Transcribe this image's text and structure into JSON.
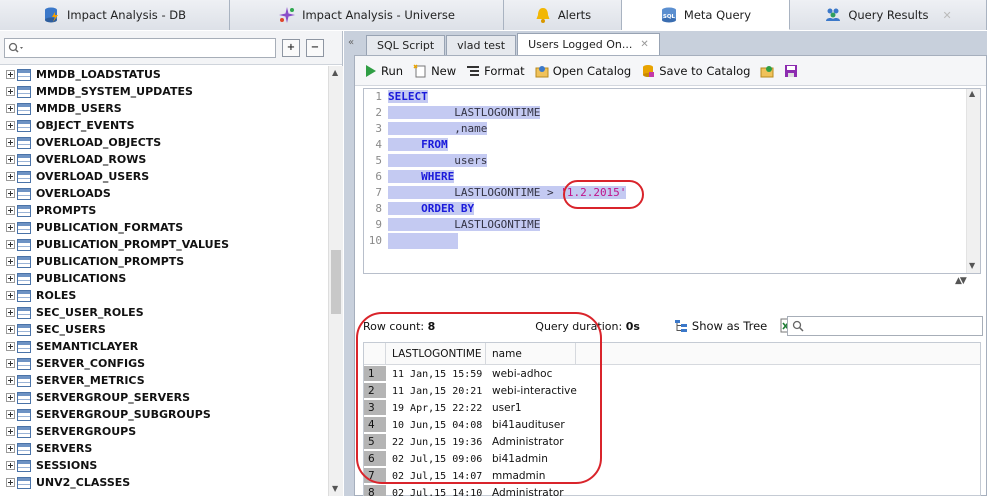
{
  "top_tabs": [
    {
      "label": "Impact Analysis - DB",
      "icon": "database-bolt-icon"
    },
    {
      "label": "Impact Analysis - Universe",
      "icon": "universe-spark-icon"
    },
    {
      "label": "Alerts",
      "icon": "bell-icon"
    },
    {
      "label": "Meta Query",
      "icon": "sql-database-icon",
      "active": true
    },
    {
      "label": "Query Results",
      "icon": "users-group-icon",
      "close": "✕"
    }
  ],
  "left": {
    "search_placeholder": "",
    "expand_all": "+",
    "collapse_all": "−",
    "tree_items": [
      "MMDB_LOADSTATUS",
      "MMDB_SYSTEM_UPDATES",
      "MMDB_USERS",
      "OBJECT_EVENTS",
      "OVERLOAD_OBJECTS",
      "OVERLOAD_ROWS",
      "OVERLOAD_USERS",
      "OVERLOADS",
      "PROMPTS",
      "PUBLICATION_FORMATS",
      "PUBLICATION_PROMPT_VALUES",
      "PUBLICATION_PROMPTS",
      "PUBLICATIONS",
      "ROLES",
      "SEC_USER_ROLES",
      "SEC_USERS",
      "SEMANTICLAYER",
      "SERVER_CONFIGS",
      "SERVER_METRICS",
      "SERVERGROUP_SERVERS",
      "SERVERGROUP_SUBGROUPS",
      "SERVERGROUPS",
      "SERVERS",
      "SESSIONS",
      "UNV2_CLASSES"
    ]
  },
  "doc_tabs": [
    {
      "label": "SQL Script"
    },
    {
      "label": "vlad test"
    },
    {
      "label": "Users Logged On...",
      "active": true,
      "close": "✕"
    }
  ],
  "toolbar": {
    "run": "Run",
    "new": "New",
    "format": "Format",
    "open_catalog": "Open Catalog",
    "save_to_catalog": "Save to Catalog"
  },
  "code_lines": [
    {
      "n": "1",
      "indent": "",
      "text": "SELECT",
      "kind": "kw"
    },
    {
      "n": "2",
      "indent": "          ",
      "text": "LASTLOGONTIME",
      "kind": "id"
    },
    {
      "n": "3",
      "indent": "          ",
      "text": ",name",
      "kind": "id"
    },
    {
      "n": "4",
      "indent": "     ",
      "text": "FROM",
      "kind": "kw"
    },
    {
      "n": "5",
      "indent": "          ",
      "text": "users",
      "kind": "id"
    },
    {
      "n": "6",
      "indent": "     ",
      "text": "WHERE",
      "kind": "kw"
    },
    {
      "n": "7",
      "indent": "          ",
      "text": "LASTLOGONTIME > ",
      "kind": "id",
      "string": "'1.2.2015'"
    },
    {
      "n": "8",
      "indent": "     ",
      "text": "ORDER BY",
      "kind": "kw"
    },
    {
      "n": "9",
      "indent": "          ",
      "text": "LASTLOGONTIME",
      "kind": "id"
    },
    {
      "n": "10",
      "indent": "",
      "text": "",
      "kind": "id"
    }
  ],
  "status": {
    "row_count_label": "Row count:",
    "row_count": "8",
    "duration_label": "Query duration:",
    "duration": "0s",
    "show_as_tree": "Show as Tree",
    "search_placeholder": ""
  },
  "results": {
    "columns": [
      "LASTLOGONTIME",
      "name"
    ],
    "rows": [
      {
        "n": "1",
        "time": "11 Jan,15 15:59",
        "name": "webi-adhoc"
      },
      {
        "n": "2",
        "time": "11 Jan,15 20:21",
        "name": "webi-interactive"
      },
      {
        "n": "3",
        "time": "19 Apr,15 22:22",
        "name": "user1"
      },
      {
        "n": "4",
        "time": "10 Jun,15 04:08",
        "name": "bi41audituser"
      },
      {
        "n": "5",
        "time": "22 Jun,15 19:36",
        "name": "Administrator"
      },
      {
        "n": "6",
        "time": "02 Jul,15 09:06",
        "name": "bi41admin"
      },
      {
        "n": "7",
        "time": "02 Jul,15 14:07",
        "name": "mmadmin"
      },
      {
        "n": "8",
        "time": "02 Jul,15 14:10",
        "name": "Administrator"
      }
    ]
  },
  "colors": {
    "keyword": "#1a1adb",
    "string": "#c0128a",
    "selection": "#c4caf2",
    "annotation": "#d9242b"
  }
}
